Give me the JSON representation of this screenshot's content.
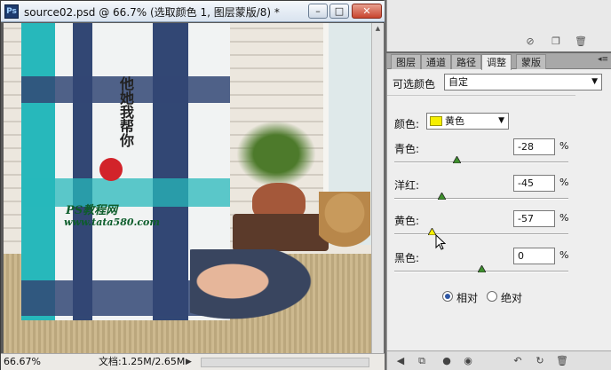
{
  "document": {
    "title": "source02.psd @ 66.7% (选取颜色 1, 图层蒙版/8) *",
    "app_icon_text": "Ps",
    "zoom": "66.67%",
    "doc_size": "文档:1.25M/2.65M",
    "canvas_text": {
      "calligraphy": "他她我帮你",
      "brand": "PS教程网",
      "url": "www.tata580.com"
    }
  },
  "window_controls": {
    "minimize": "–",
    "maximize": "□",
    "close": "✕"
  },
  "adjustments_panel": {
    "tabs": [
      {
        "label": "图层",
        "active": false
      },
      {
        "label": "通道",
        "active": false
      },
      {
        "label": "路径",
        "active": false
      },
      {
        "label": "调整",
        "active": true
      },
      {
        "label": "蒙版",
        "active": false
      }
    ],
    "preset_label": "可选颜色",
    "preset_value": "自定",
    "color_label": "颜色:",
    "color_value": "黄色",
    "color_swatch": "#f6ef00",
    "sliders": [
      {
        "label": "青色:",
        "value": "-28",
        "level": -28
      },
      {
        "label": "洋红:",
        "value": "-45",
        "level": -45
      },
      {
        "label": "黄色:",
        "value": "-57",
        "level": -57
      },
      {
        "label": "黑色:",
        "value": "0",
        "level": 0
      }
    ],
    "percent": "%",
    "method": {
      "relative": "相对",
      "absolute": "绝对",
      "selected": "relative"
    }
  },
  "icons": {
    "panel_menu": "menu-icon",
    "dropdown": "chevron-down-icon"
  }
}
